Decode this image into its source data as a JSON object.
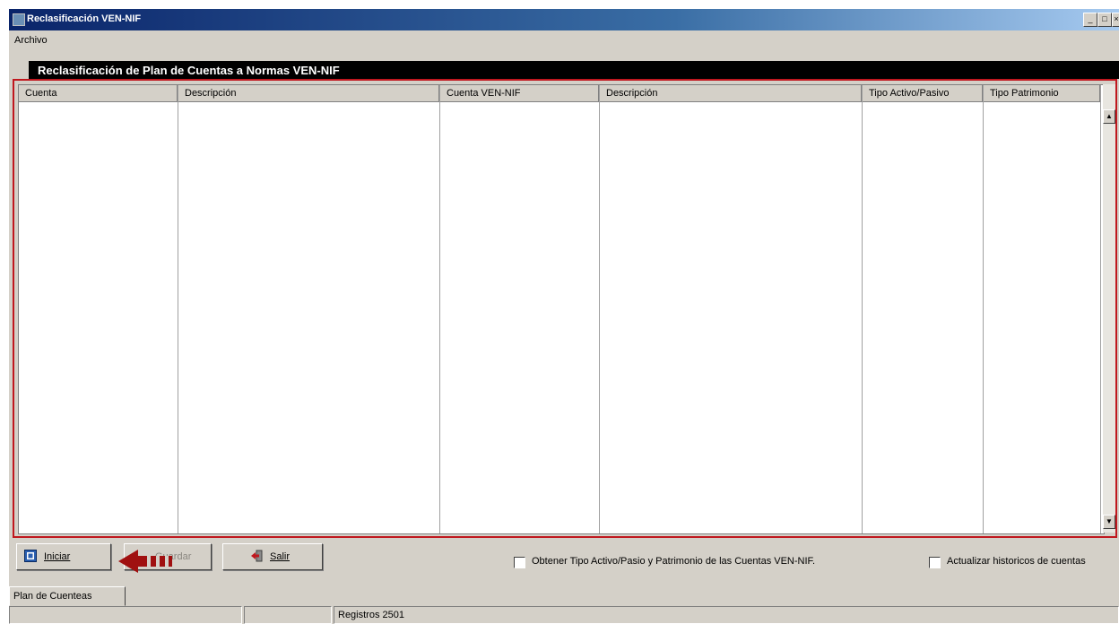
{
  "window": {
    "title": "Reclasificación VEN-NIF",
    "minimize": "_",
    "maximize": "□",
    "close": "×"
  },
  "menu": {
    "items": [
      {
        "label": "Archivo"
      }
    ]
  },
  "grid": {
    "title": "Reclasificación de Plan de Cuentas a  Normas VEN-NIF",
    "columns": [
      "Cuenta",
      "Descripción",
      "Cuenta VEN-NIF",
      "Descripción",
      "Tipo Activo/Pasivo",
      "Tipo Patrimonio"
    ],
    "rows": []
  },
  "buttons": {
    "iniciar": "Iniciar",
    "guardar": "Guardar",
    "salir": "Salir"
  },
  "checkboxes": {
    "obtener": {
      "label": "Obtener Tipo Activo/Pasio y Patrimonio de las Cuentas VEN-NIF.",
      "checked": false
    },
    "actualizar": {
      "label": "Actualizar historicos de cuentas",
      "checked": false
    }
  },
  "tabs": [
    {
      "label": "Plan de Cuenteas"
    }
  ],
  "status": {
    "registros": "Registros 2501"
  },
  "colors": {
    "highlight_border": "#c0171e",
    "arrow": "#a01010",
    "title_bar": "#0a246a"
  }
}
